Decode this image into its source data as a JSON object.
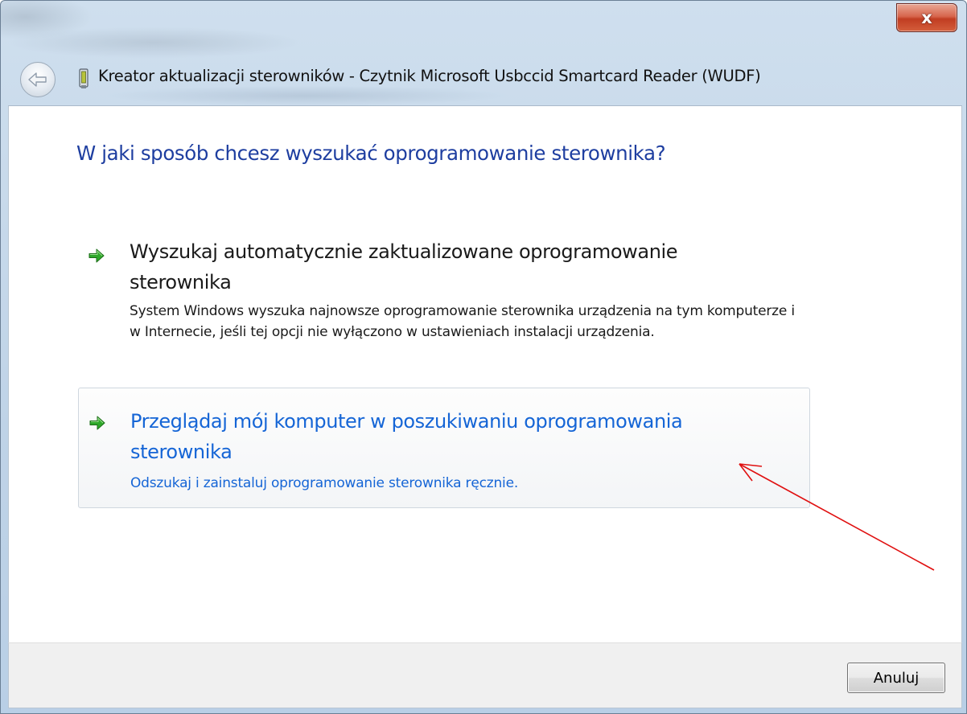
{
  "window": {
    "title": "Kreator aktualizacji sterowników - Czytnik Microsoft Usbccid Smartcard Reader (WUDF)",
    "close_label": "x",
    "back_icon": "back-arrow-icon",
    "device_icon": "smartcard-reader-icon"
  },
  "main": {
    "heading": "W jaki sposób chcesz wyszukać oprogramowanie sterownika?",
    "options": [
      {
        "icon": "green-arrow-icon",
        "title": "Wyszukaj automatycznie zaktualizowane oprogramowanie sterownika",
        "description": "System Windows wyszuka najnowsze oprogramowanie sterownika urządzenia na tym komputerze i w Internecie, jeśli tej opcji nie wyłączono w ustawieniach instalacji urządzenia."
      },
      {
        "icon": "green-arrow-icon",
        "title": "Przeglądaj mój komputer w poszukiwaniu oprogramowania sterownika",
        "description": "Odszukaj i zainstaluj oprogramowanie sterownika ręcznie.",
        "state": "hovered"
      }
    ]
  },
  "footer": {
    "cancel_label": "Anuluj"
  },
  "colors": {
    "heading": "#1e3ea0",
    "link_hover": "#1565d6",
    "annotation_arrow": "#e01010",
    "close_button": "#c13d22"
  }
}
